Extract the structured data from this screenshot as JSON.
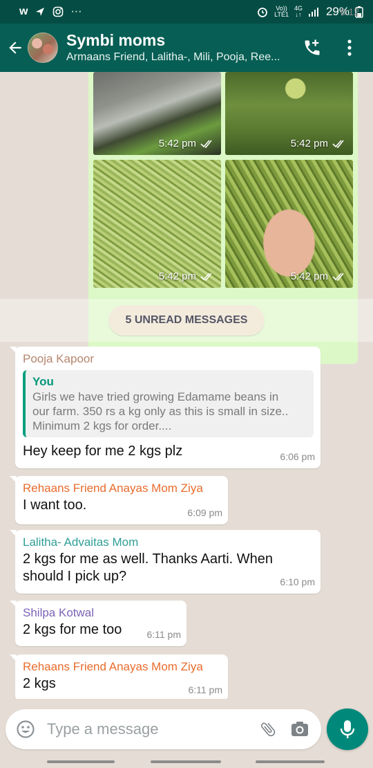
{
  "status_bar": {
    "time": "6:12",
    "volte_top": "Vo))",
    "volte_bottom": "LTE1",
    "network_top": "4G",
    "network_bottom": "↓↑",
    "battery": "29%"
  },
  "header": {
    "title": "Symbi moms",
    "subtitle": "Armaans Friend, Lalitha-, Mili, Pooja, Ree..."
  },
  "media": {
    "timestamps": [
      "5:42 pm",
      "5:42 pm",
      "5:42 pm",
      "5:42 pm"
    ]
  },
  "unread_label": "5 UNREAD MESSAGES",
  "messages": [
    {
      "sender": "Pooja Kapoor",
      "sender_color": "#b5856c",
      "quote": {
        "name": "You",
        "lines": [
          "Girls we have tried growing Edamame beans in",
          "our farm. 350 rs a kg only as this is small in size..",
          "Minimum 2 kgs for order...."
        ]
      },
      "text": "Hey keep for me 2 kgs plz",
      "time": "6:06 pm"
    },
    {
      "sender": "Rehaans Friend Anayas Mom Ziya",
      "sender_color": "#e96b2c",
      "text": "I want too.",
      "time": "6:09 pm"
    },
    {
      "sender": "Lalitha- Advaitas Mom",
      "sender_color": "#2e9e96",
      "text_lines": [
        "2 kgs for me as well. Thanks Aarti. When",
        "should I pick up?"
      ],
      "time": "6:10 pm"
    },
    {
      "sender": "Shilpa Kotwal",
      "sender_color": "#7c63b5",
      "text": "2 kgs for me too",
      "time": "6:11 pm"
    },
    {
      "sender": "Rehaans Friend Anayas Mom Ziya",
      "sender_color": "#e96b2c",
      "text": "2 kgs",
      "time": "6:11 pm"
    }
  ],
  "input": {
    "placeholder": "Type a message"
  },
  "colors": {
    "header": "#075e54",
    "status_bar": "#054d44",
    "mic": "#00897b",
    "sent_bubble": "#dcf8c6",
    "chat_bg": "#e5ddd5"
  },
  "icons": {
    "back": "back-arrow-icon",
    "call": "add-call-icon",
    "menu": "more-vertical-icon",
    "emoji": "emoji-icon",
    "attach": "paperclip-icon",
    "camera": "camera-icon",
    "mic": "mic-icon",
    "read": "double-check-icon"
  }
}
